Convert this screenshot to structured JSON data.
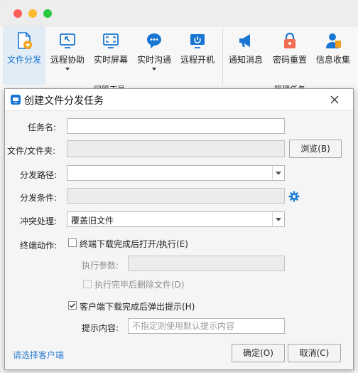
{
  "toolbar": {
    "items": [
      {
        "label": "文件分发"
      },
      {
        "label": "远程协助"
      },
      {
        "label": "实时屏幕"
      },
      {
        "label": "实时沟通"
      },
      {
        "label": "远程开机"
      },
      {
        "label": "通知消息"
      },
      {
        "label": "密码重置"
      },
      {
        "label": "信息收集"
      }
    ],
    "group1_label": "网管工具",
    "group2_label": "管理任务"
  },
  "dialog": {
    "title": "创建文件分发任务",
    "task_name_label": "任务名:",
    "task_name_value": "",
    "file_label": "文件/文件夹:",
    "browse_label": "浏览(B)",
    "path_label": "分发路径:",
    "path_value": "",
    "condition_label": "分发条件:",
    "conflict_label": "冲突处理:",
    "conflict_value": "覆盖旧文件",
    "action_label": "终端动作:",
    "open_after_label": "终端下载完成后打开/执行(E)",
    "exec_params_label": "执行参数:",
    "delete_after_label": "执行完毕后删除文件(D)",
    "popup_label": "客户端下载完成后弹出提示(H)",
    "hint_label": "提示内容:",
    "hint_placeholder": "不指定则使用默认提示内容",
    "select_client_link": "请选择客户端",
    "ok_label": "确定(O)",
    "cancel_label": "取消(C)"
  },
  "colors": {
    "accent": "#1976d2",
    "link": "#2f7fd1",
    "gear": "#1f7fd4"
  }
}
